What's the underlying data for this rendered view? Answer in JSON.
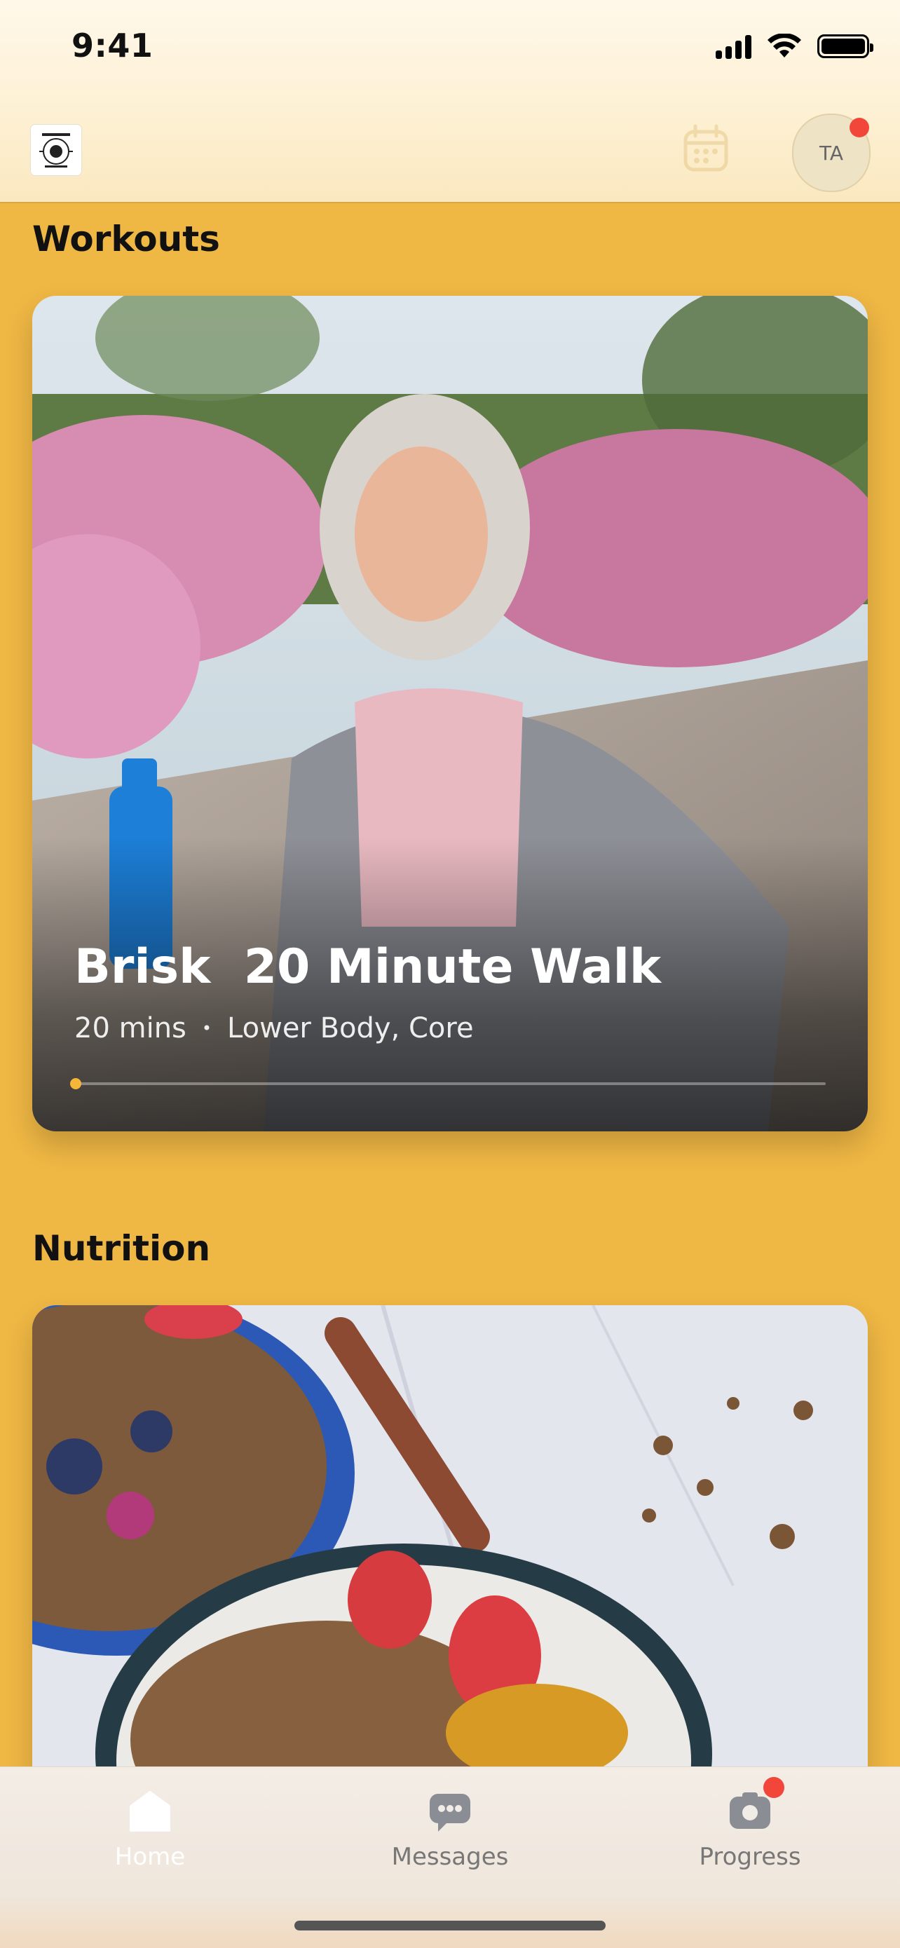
{
  "status_bar": {
    "time": "9:41"
  },
  "header": {
    "avatar_initials": "TA",
    "icons": {
      "logo": "brand-logo",
      "calendar": "calendar-icon",
      "notification": "notification-dot"
    }
  },
  "sections": {
    "workouts": {
      "title": "Workouts",
      "card": {
        "title": "Brisk  20 Minute Walk",
        "duration": "20 mins",
        "separator": "•",
        "focus": "Lower Body, Core",
        "progress_percent": 0
      }
    },
    "nutrition": {
      "title": "Nutrition"
    }
  },
  "tabbar": {
    "items": [
      {
        "label": "Home",
        "icon": "home-icon",
        "active": true
      },
      {
        "label": "Messages",
        "icon": "message-icon",
        "active": false
      },
      {
        "label": "Progress",
        "icon": "camera-icon",
        "active": false,
        "badge": true
      }
    ]
  },
  "colors": {
    "background": "#EFB744",
    "accent": "#F5B63A",
    "badge": "#F2463A"
  }
}
